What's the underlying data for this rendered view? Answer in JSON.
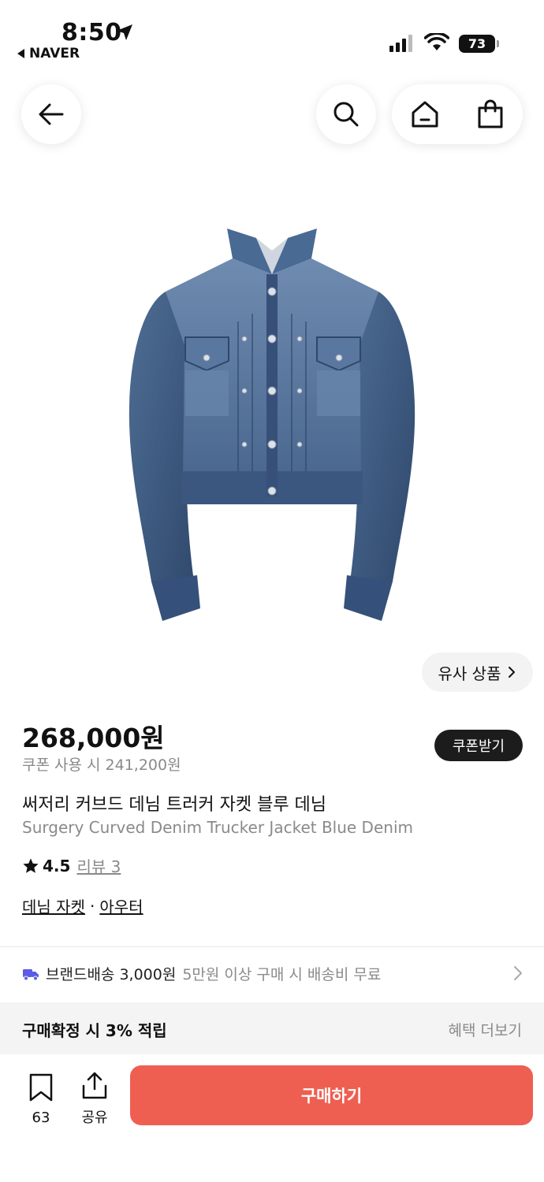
{
  "status_bar": {
    "time": "8:50",
    "back_app": "NAVER",
    "battery": "73"
  },
  "nav": {
    "back_icon": "arrow-left-icon",
    "search_icon": "search-icon",
    "home_icon": "home-icon",
    "cart_icon": "shopping-bag-icon"
  },
  "product": {
    "similar_label": "유사 상품",
    "price": "268,000원",
    "coupon_price": "쿠폰 사용 시 241,200원",
    "coupon_button": "쿠폰받기",
    "name_ko": "써저리 커브드 데님 트러커 자켓 블루 데님",
    "name_en": "Surgery Curved Denim Trucker Jacket Blue Denim",
    "rating": "4.5",
    "review_label": "리뷰 3",
    "category_1": "데님 자켓",
    "category_sep": "·",
    "category_2": "아우터"
  },
  "shipping": {
    "icon": "truck-icon",
    "label": "브랜드배송 3,000원",
    "sub": "5만원 이상 구매 시 배송비 무료"
  },
  "benefit": {
    "title": "구매확정 시 3% 적립",
    "more": "혜택 더보기"
  },
  "bottom": {
    "wish_count": "63",
    "share_label": "공유",
    "buy_label": "구매하기"
  },
  "colors": {
    "buy_button": "#ee5f51",
    "coupon_button": "#1c1c1c",
    "truck_icon": "#5b5be6",
    "denim": "#3e5a80"
  }
}
